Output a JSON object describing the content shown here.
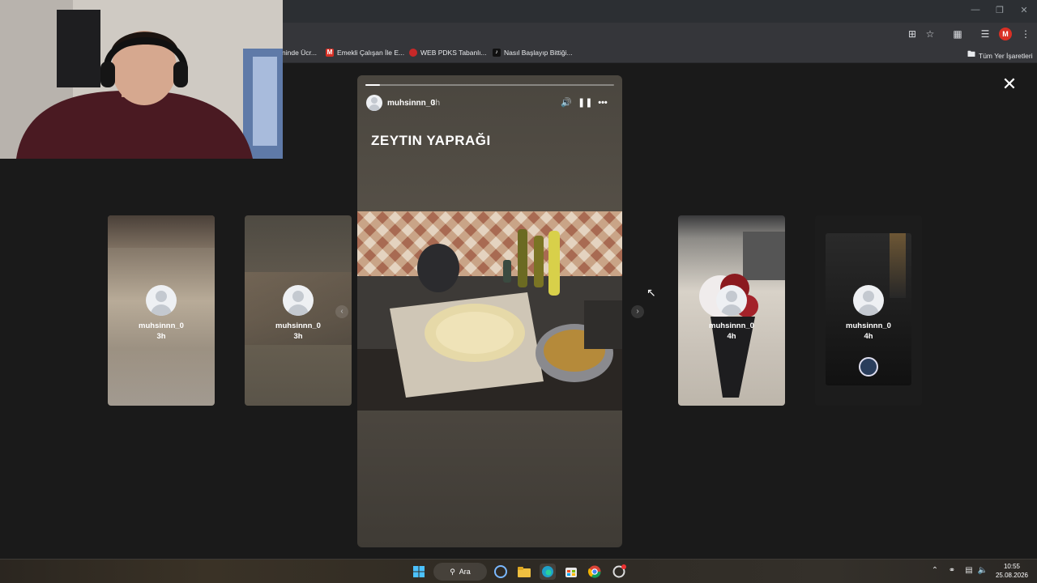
{
  "window": {
    "minimize_icon": "minimize-icon",
    "maximize_icon": "restore-icon",
    "close_icon": "close-icon"
  },
  "bookmarks": [
    {
      "label": "ninde Ücr...",
      "icon": "globe-icon"
    },
    {
      "label": "Emekli Çalışan İle E...",
      "icon": "m-logo-icon",
      "color": "#d93025"
    },
    {
      "label": "WEB PDKS Tabanlı...",
      "icon": "pin-icon",
      "color": "#c62828"
    },
    {
      "label": "Nasıl Başlayıp Bittiği...",
      "icon": "tiktok-icon"
    }
  ],
  "all_bookmarks": "Tüm Yer İşaretleri",
  "profile_initial": "M",
  "stories": {
    "left": [
      {
        "username": "muhsinnn_0",
        "time": "3h"
      },
      {
        "username": "muhsinnn_0",
        "time": "3h"
      }
    ],
    "right": [
      {
        "username": "muhsinnn_0",
        "time": "4h"
      },
      {
        "username": "muhsinnn_0",
        "time": "4h"
      }
    ],
    "active": {
      "username": "muhsinnn_0",
      "time": "3h",
      "caption": "ZEYTIN YAPRAĞI",
      "progress": 0.06
    }
  },
  "taskbar": {
    "search_label": "Ara",
    "time": "10:55",
    "date": "25.08.2026"
  }
}
